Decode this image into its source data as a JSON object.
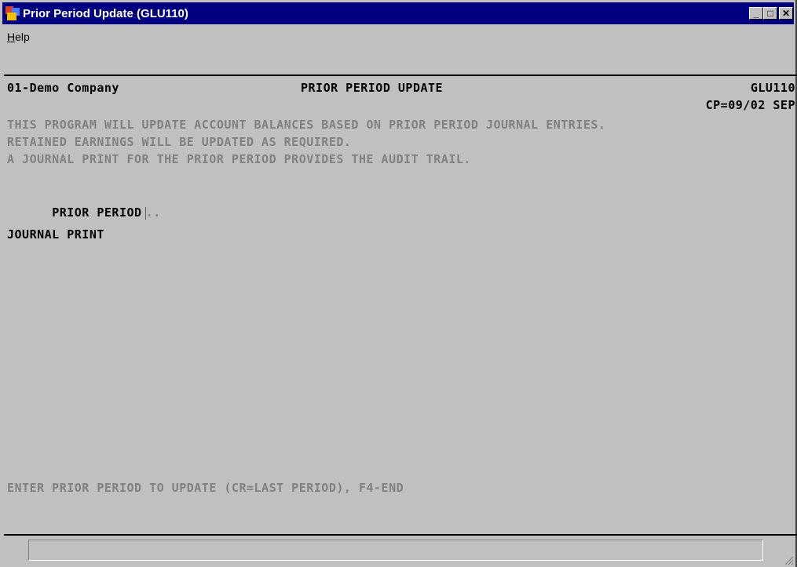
{
  "window": {
    "title": "Prior Period Update (GLU110)",
    "controls": {
      "minimize": "_",
      "maximize": "□",
      "close": "✕"
    }
  },
  "menu": {
    "help": "Help"
  },
  "screen": {
    "company": "01-Demo Company",
    "heading": "PRIOR PERIOD UPDATE",
    "program_id": "GLU110",
    "current_period": "CP=09/02 SEP",
    "description": [
      "THIS PROGRAM WILL UPDATE ACCOUNT BALANCES BASED ON PRIOR PERIOD JOURNAL ENTRIES.",
      "RETAINED EARNINGS WILL BE UPDATED AS REQUIRED.",
      "A JOURNAL PRINT FOR THE PRIOR PERIOD PROVIDES THE AUDIT TRAIL."
    ],
    "prior_period_label": "PRIOR PERIOD",
    "prior_period_value": "..",
    "journal_print_label": "JOURNAL PRINT",
    "prompt": "ENTER PRIOR PERIOD TO UPDATE (CR=LAST PERIOD), F4-END"
  },
  "status": {
    "text": ""
  }
}
